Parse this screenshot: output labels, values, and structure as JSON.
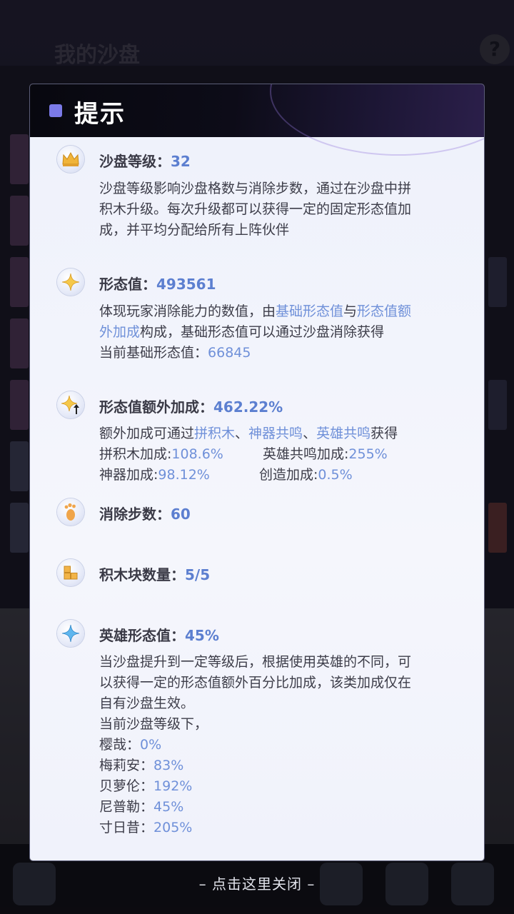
{
  "background": {
    "title": "我的沙盘",
    "help_symbol": "?"
  },
  "dialog": {
    "title": "提示",
    "accent_color": "#7b7ae8",
    "sections": {
      "level": {
        "icon": "crown-icon",
        "label": "沙盘等级：",
        "value": "32",
        "lines": [
          "沙盘等级影响沙盘格数与消除步数，通过在沙盘中拼",
          "积木升级。每次升级都可以获得一定的固定形态值加",
          "成，并平均分配给所有上阵伙伴"
        ]
      },
      "form_value": {
        "icon": "star-sparkle-icon",
        "label": "形态值：",
        "value": "493561",
        "line1_pre": "体现玩家消除能力的数值，由",
        "link_base": "基础形态值",
        "line1_mid": "与",
        "link_extra_part1": "形态值额",
        "link_extra_part2": "外加成",
        "line2_rest": "构成，基础形态值可以通过沙盘消除获得",
        "current_label": "当前基础形态值：",
        "current_value": "66845"
      },
      "extra_bonus": {
        "icon": "star-arrow-up-icon",
        "label": "形态值额外加成：",
        "value": "462.22%",
        "intro_pre": "额外加成可通过",
        "link_blocks": "拼积木",
        "sep1": "、",
        "link_artifact": "神器共鸣",
        "sep2": "、",
        "link_hero": "英雄共鸣",
        "intro_post": "获得",
        "blocks_label": "拼积木加成:",
        "blocks_value": "108.6%",
        "hero_label": "英雄共鸣加成:",
        "hero_value": "255%",
        "artifact_label": "神器加成:",
        "artifact_value": "98.12%",
        "create_label": "创造加成:",
        "create_value": "0.5%"
      },
      "steps": {
        "icon": "footprint-icon",
        "label": "消除步数：",
        "value": "60"
      },
      "blocks": {
        "icon": "blocks-icon",
        "label": "积木块数量：",
        "value": "5/5"
      },
      "hero_form": {
        "icon": "blue-sparkle-icon",
        "label": "英雄形态值：",
        "value": "45%",
        "lines": [
          "当沙盘提升到一定等级后，根据使用英雄的不同，可",
          "以获得一定的形态值额外百分比加成，该类加成仅在",
          "自有沙盘生效。",
          "当前沙盘等级下，"
        ],
        "heroes": [
          {
            "name": "樱哉：",
            "value": "0%"
          },
          {
            "name": "梅莉安：",
            "value": "83%"
          },
          {
            "name": "贝萝伦：",
            "value": "192%"
          },
          {
            "name": "尼普勒：",
            "value": "45%"
          },
          {
            "name": "寸日昔：",
            "value": "205%"
          }
        ]
      }
    }
  },
  "close_hint": "– 点击这里关闭 –"
}
